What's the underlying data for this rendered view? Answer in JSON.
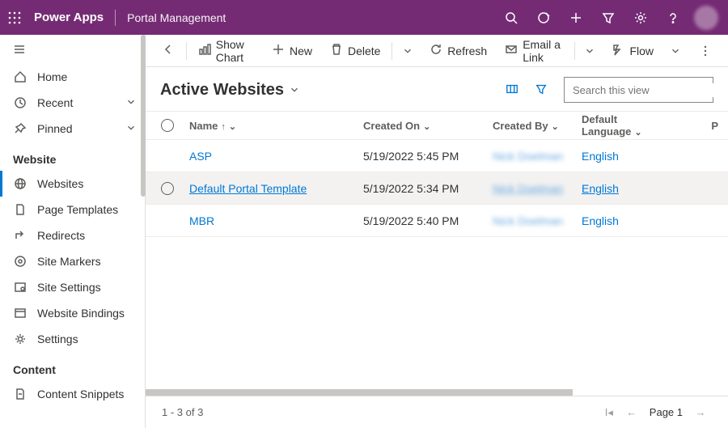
{
  "header": {
    "brand": "Power Apps",
    "area": "Portal Management"
  },
  "sidebar": {
    "global": [
      {
        "label": "Home"
      },
      {
        "label": "Recent"
      },
      {
        "label": "Pinned"
      }
    ],
    "sections": [
      {
        "title": "Website",
        "items": [
          {
            "label": "Websites",
            "selected": true
          },
          {
            "label": "Page Templates"
          },
          {
            "label": "Redirects"
          },
          {
            "label": "Site Markers"
          },
          {
            "label": "Site Settings"
          },
          {
            "label": "Website Bindings"
          },
          {
            "label": "Settings"
          }
        ]
      },
      {
        "title": "Content",
        "items": [
          {
            "label": "Content Snippets"
          }
        ]
      }
    ]
  },
  "toolbar": {
    "show_chart": "Show Chart",
    "new": "New",
    "delete": "Delete",
    "refresh": "Refresh",
    "email_link": "Email a Link",
    "flow": "Flow"
  },
  "view": {
    "title": "Active Websites",
    "search_placeholder": "Search this view"
  },
  "columns": {
    "name": "Name",
    "created_on": "Created On",
    "created_by": "Created By",
    "default_language": "Default Language",
    "last": "P"
  },
  "rows": [
    {
      "name": "ASP",
      "created_on": "5/19/2022 5:45 PM",
      "created_by": "Nick Doelman",
      "language": "English"
    },
    {
      "name": "Default Portal Template",
      "created_on": "5/19/2022 5:34 PM",
      "created_by": "Nick Doelman",
      "language": "English",
      "hover": true
    },
    {
      "name": "MBR",
      "created_on": "5/19/2022 5:40 PM",
      "created_by": "Nick Doelman",
      "language": "English"
    }
  ],
  "footer": {
    "status": "1 - 3 of 3",
    "page": "Page 1"
  }
}
